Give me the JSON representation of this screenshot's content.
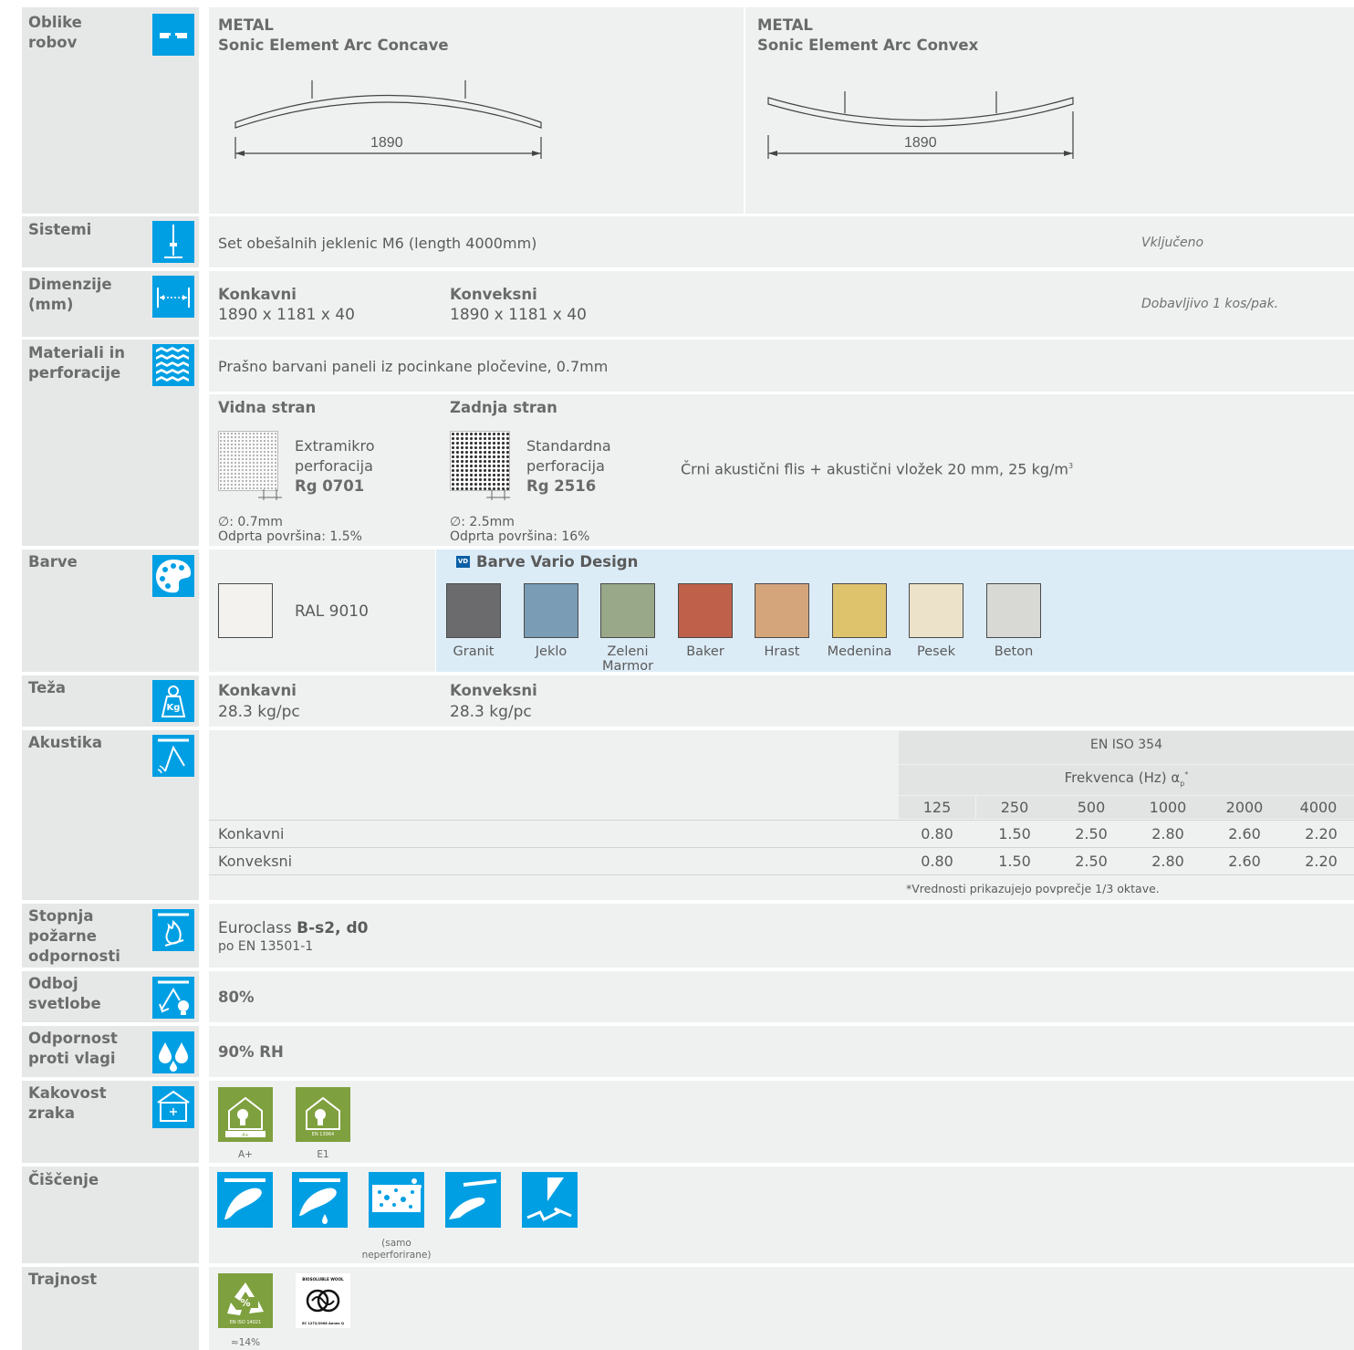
{
  "labels": {
    "oblike": "Oblike\nrobov",
    "sistemi": "Sistemi",
    "dimenzije": "Dimenzije\n(mm)",
    "materiali": "Materiali in\nperforacije",
    "barve": "Barve",
    "teza": "Teža",
    "akustika": "Akustika",
    "pozar": "Stopnja\npožarne\nodpornosti",
    "odboj": "Odboj\nsvetlobe",
    "vlaga": "Odpornost\nproti vlagi",
    "zrak": "Kakovost\nzraka",
    "ciscenje": "Čiščenje",
    "trajnost": "Trajnost"
  },
  "icons": {
    "oblike": "edge-profile-icon",
    "sistemi": "suspension-rod-icon",
    "dimenzije": "dimension-arrow-icon",
    "materiali": "perforation-pattern-icon",
    "barve": "paint-palette-icon",
    "teza": "weight-kg-icon",
    "akustika": "sound-absorption-icon",
    "pozar": "fire-resistance-icon",
    "odboj": "light-reflection-icon",
    "vlaga": "water-drops-icon",
    "zrak": "indoor-air-icon"
  },
  "shapes": {
    "concave": {
      "material": "METAL",
      "name": "Sonic Element Arc Concave",
      "dimension": "1890"
    },
    "convex": {
      "material": "METAL",
      "name": "Sonic Element Arc Convex",
      "dimension": "1890"
    }
  },
  "sistemi": {
    "text": "Set obešalnih jeklenic M6 (length 4000mm)",
    "note": "Vključeno"
  },
  "dimenzije": {
    "concave_title": "Konkavni",
    "concave_value": "1890 x 1181 x 40",
    "convex_title": "Konveksni",
    "convex_value": "1890 x 1181 x 40",
    "note": "Dobavljivo 1 kos/pak."
  },
  "materiali": {
    "text": "Prašno barvani paneli iz pocinkane pločevine, 0.7mm",
    "front_title": "Vidna stran",
    "front_line1": "Extramikro",
    "front_line2": "perforacija",
    "front_code": "Rg 0701",
    "front_diameter": "∅: 0.7mm",
    "front_open": "Odprta površina: 1.5%",
    "back_title": "Zadnja stran",
    "back_line1": "Standardna",
    "back_line2": "perforacija",
    "back_code": "Rg 2516",
    "back_diameter": "∅: 2.5mm",
    "back_open": "Odprta površina: 16%",
    "fleece": "Črni akustični flis + akustični vložek 20 mm, 25 kg/m",
    "fleece_sup": "3"
  },
  "barve": {
    "standard_name": "RAL 9010",
    "standard_color": "#f3f2ef",
    "vario_badge": "VD",
    "vario_title": "Barve Vario Design",
    "vario": [
      {
        "name": "Granit",
        "color": "#6b6b6e"
      },
      {
        "name": "Jeklo",
        "color": "#7a9cb4"
      },
      {
        "name": "Zeleni Marmor",
        "color": "#98a889"
      },
      {
        "name": "Baker",
        "color": "#bf604b"
      },
      {
        "name": "Hrast",
        "color": "#d4a47b"
      },
      {
        "name": "Medenina",
        "color": "#dfc26c"
      },
      {
        "name": "Pesek",
        "color": "#ebe2c9"
      },
      {
        "name": "Beton",
        "color": "#d8d9d5"
      }
    ]
  },
  "teza": {
    "concave_title": "Konkavni",
    "concave_value": "28.3 kg/pc",
    "convex_title": "Konveksni",
    "convex_value": "28.3 kg/pc"
  },
  "akustika": {
    "standard": "EN ISO 354",
    "freq_label": "Frekvenca (Hz) α",
    "freq_sub": "p",
    "freq_sup": "*",
    "frequencies": [
      "125",
      "250",
      "500",
      "1000",
      "2000",
      "4000"
    ],
    "rows": [
      {
        "name": "Konkavni",
        "values": [
          "0.80",
          "1.50",
          "2.50",
          "2.80",
          "2.60",
          "2.20"
        ]
      },
      {
        "name": "Konveksni",
        "values": [
          "0.80",
          "1.50",
          "2.50",
          "2.80",
          "2.60",
          "2.20"
        ]
      }
    ],
    "note": "*Vrednosti prikazujejo povprečje 1/3 oktave."
  },
  "pozar": {
    "prefix": "Euroclass ",
    "class": "B-s2, d0",
    "norm": "po EN 13501-1"
  },
  "odboj": {
    "value": "80%"
  },
  "vlaga": {
    "value": "90% RH"
  },
  "zrak": {
    "badge1_text": "A+",
    "badge1_caption": "A+",
    "badge2_text": "EN 13964",
    "badge2_caption": "E1"
  },
  "ciscenje": {
    "note_line1": "(samo",
    "note_line2": "neperforirane)"
  },
  "trajnost": {
    "recycle_badge": "EN ISO 14021",
    "recycle_caption": "≈14%",
    "wool_top": "BIOSOLUBLE WOOL",
    "wool_bottom": "EC 1272/2008 Annex Q"
  }
}
